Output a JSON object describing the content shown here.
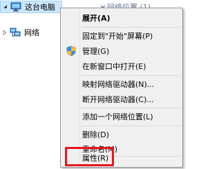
{
  "tree": {
    "this_pc": {
      "label": "这台电脑",
      "expanded": true,
      "selected": true,
      "icon": "computer-icon"
    },
    "network": {
      "label": "网络",
      "expanded": false,
      "icon": "network-icon"
    }
  },
  "right_pane": {
    "group_header": "网络位置 (1)"
  },
  "context_menu": {
    "items": [
      {
        "label": "展开(A)",
        "bold": true
      },
      {
        "label": "固定到\"开始\"屏幕(P)"
      },
      {
        "label": "管理(G)",
        "icon": "uac-shield-icon"
      },
      {
        "label": "在新窗口中打开(E)"
      },
      {
        "label": "映射网络驱动器(N)..."
      },
      {
        "label": "断开网络驱动器(C)..."
      },
      {
        "label": "添加一个网络位置(L)"
      },
      {
        "label": "删除(D)"
      },
      {
        "label": "重命名(M)"
      },
      {
        "label": "属性(R)"
      }
    ]
  },
  "colors": {
    "highlight_box": "#e8141b",
    "selection_bg": "#cce8ff",
    "menu_bg": "#f0f0f0"
  }
}
